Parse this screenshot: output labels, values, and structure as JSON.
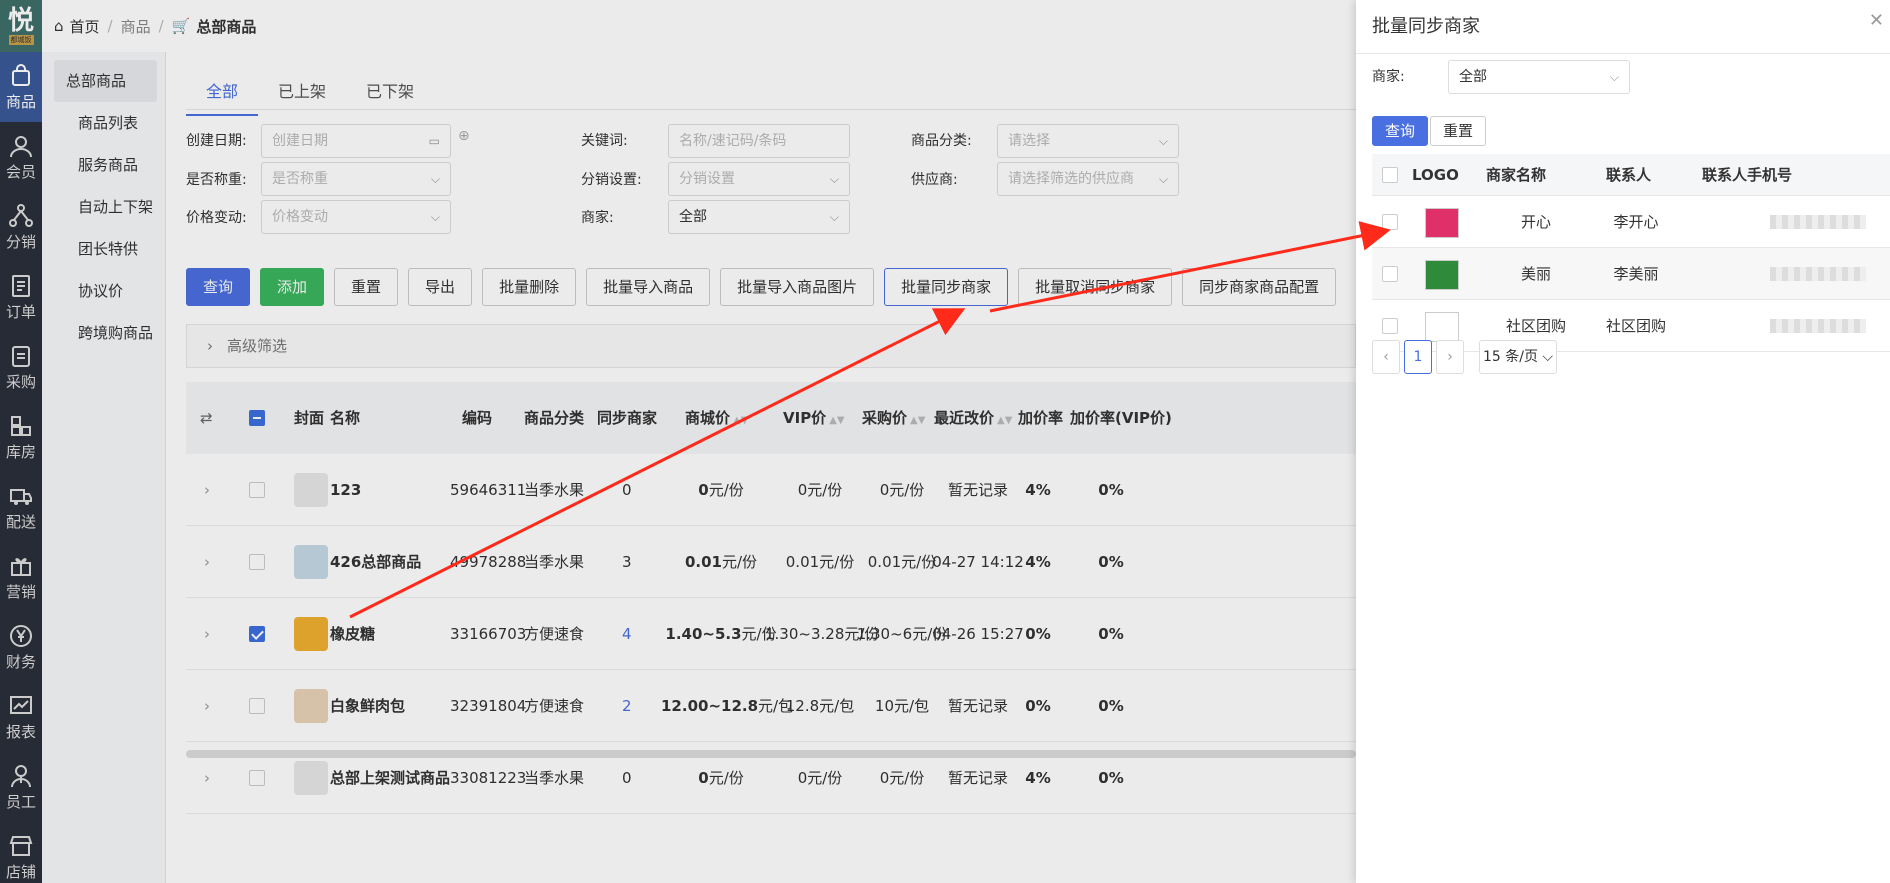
{
  "sidebar": {
    "logo_char": "悦",
    "logo_sub": "都城饭",
    "items": [
      {
        "label": "商品",
        "icon": "bag-icon",
        "active": true
      },
      {
        "label": "会员",
        "icon": "user-icon"
      },
      {
        "label": "分销",
        "icon": "network-icon"
      },
      {
        "label": "订单",
        "icon": "document-icon"
      },
      {
        "label": "采购",
        "icon": "clipboard-icon"
      },
      {
        "label": "库房",
        "icon": "boxes-icon"
      },
      {
        "label": "配送",
        "icon": "truck-icon"
      },
      {
        "label": "营销",
        "icon": "gift-icon"
      },
      {
        "label": "财务",
        "icon": "yen-icon"
      },
      {
        "label": "报表",
        "icon": "chart-icon"
      },
      {
        "label": "员工",
        "icon": "staff-icon"
      },
      {
        "label": "店铺",
        "icon": "store-icon"
      }
    ]
  },
  "subnav": [
    "总部商品",
    "商品列表",
    "服务商品",
    "自动上下架",
    "团长特供",
    "协议价",
    "跨境购商品"
  ],
  "breadcrumb": {
    "home": "首页",
    "level2": "商品",
    "current": "总部商品"
  },
  "tabs": [
    "全部",
    "已上架",
    "已下架"
  ],
  "filters": {
    "create_date_label": "创建日期:",
    "create_date_ph": "创建日期",
    "keyword_label": "关键词:",
    "keyword_ph": "名称/速记码/条码",
    "category_label": "商品分类:",
    "category_ph": "请选择",
    "weigh_label": "是否称重:",
    "weigh_ph": "是否称重",
    "dist_label": "分销设置:",
    "dist_ph": "分销设置",
    "supplier_label": "供应商:",
    "supplier_ph": "请选择筛选的供应商",
    "price_label": "价格变动:",
    "price_ph": "价格变动",
    "merchant_label": "商家:",
    "merchant_value": "全部"
  },
  "buttons": [
    "查询",
    "添加",
    "重置",
    "导出",
    "批量删除",
    "批量导入商品",
    "批量导入商品图片",
    "批量同步商家",
    "批量取消同步商家",
    "同步商家商品配置"
  ],
  "advanced": "高级筛选",
  "columns": {
    "cover": "封面",
    "name": "名称",
    "code": "编码",
    "category": "商品分类",
    "sync": "同步商家",
    "mall": "商城价",
    "vip": "VIP价",
    "purchase": "采购价",
    "recent": "最近改价",
    "markup": "加价率",
    "markup_vip": "加价率(VIP价)"
  },
  "rows": [
    {
      "name": "123",
      "code": "59646311",
      "category": "当季水果",
      "sync": "0",
      "mall_num": "0",
      "mall_unit": "元/份",
      "vip": "0元/份",
      "purchase": "0元/份",
      "recent": "暂无记录",
      "markup": "4%",
      "markup_vip": "0%",
      "checked": false,
      "thumb": "#e8e8e8"
    },
    {
      "name": "426总部商品",
      "code": "49978288",
      "category": "当季水果",
      "sync": "3",
      "mall_num": "0.01",
      "mall_unit": "元/份",
      "vip": "0.01元/份",
      "purchase": "0.01元/份",
      "recent": "04-27 14:12",
      "markup": "4%",
      "markup_vip": "0%",
      "checked": false,
      "thumb": "#c7d9e8"
    },
    {
      "name": "橡皮糖",
      "code": "33166703",
      "category": "方便速食",
      "sync": "4",
      "mall_num": "1.40~5.3",
      "mall_unit": "元/份",
      "vip": "1.30~3.28元/份",
      "purchase": "1.30~6元/份",
      "recent": "04-26 15:27",
      "markup": "0%",
      "markup_vip": "0%",
      "checked": true,
      "thumb": "#f0b030"
    },
    {
      "name": "白象鲜肉包",
      "code": "32391804",
      "category": "方便速食",
      "sync": "2",
      "mall_num": "12.00~12.8",
      "mall_unit": "元/包",
      "vip": "12.8元/包",
      "purchase": "10元/包",
      "recent": "暂无记录",
      "markup": "0%",
      "markup_vip": "0%",
      "checked": false,
      "thumb": "#e9d3b8"
    },
    {
      "name": "总部上架测试商品",
      "code": "33081223",
      "category": "当季水果",
      "sync": "0",
      "mall_num": "0",
      "mall_unit": "元/份",
      "vip": "0元/份",
      "purchase": "0元/份",
      "recent": "暂无记录",
      "markup": "4%",
      "markup_vip": "0%",
      "checked": false,
      "thumb": "#e8e8e8"
    }
  ],
  "drawer": {
    "title": "批量同步商家",
    "merchant_label": "商家:",
    "merchant_value": "全部",
    "query": "查询",
    "reset": "重置",
    "columns": {
      "logo": "LOGO",
      "name": "商家名称",
      "contact": "联系人",
      "phone": "联系人手机号"
    },
    "rows": [
      {
        "name": "开心",
        "contact": "李开心",
        "logo": "#e0306a"
      },
      {
        "name": "美丽",
        "contact": "李美丽",
        "logo": "#2f8a3a"
      },
      {
        "name": "社区团购",
        "contact": "社区团购",
        "logo": "#ffffff"
      }
    ],
    "page": "1",
    "page_size": "15 条/页"
  },
  "colors": {
    "primary": "#4a6fe0",
    "success": "#3bb55f",
    "sidebar": "#2b2f3a",
    "arrow": "#ff2a1a"
  }
}
